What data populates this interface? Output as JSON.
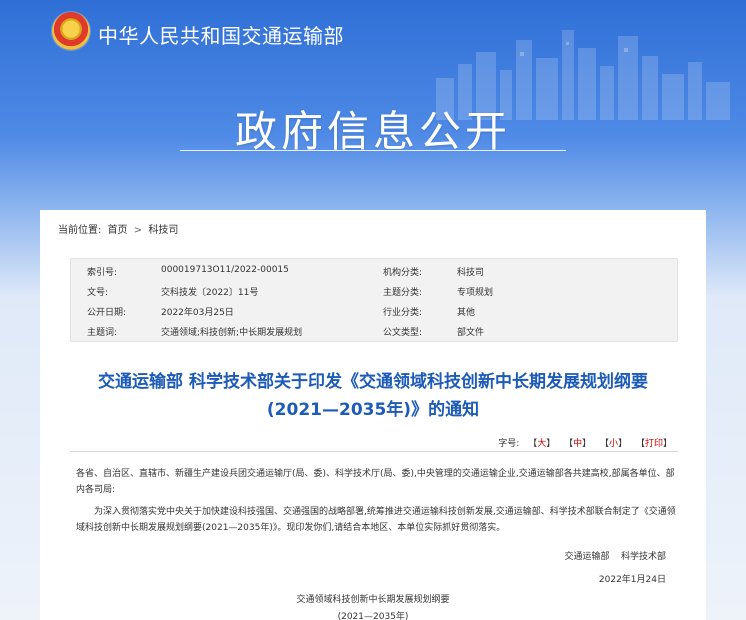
{
  "header": {
    "ministry_name": "中华人民共和国交通运输部",
    "banner_title": "政府信息公开"
  },
  "breadcrumb": {
    "label": "当前位置:",
    "items": [
      "首页",
      "科技司"
    ],
    "separator": ">"
  },
  "meta": {
    "rows": [
      {
        "label1": "索引号:",
        "value1": "000019713O11/2022-00015",
        "label2": "机构分类:",
        "value2": "科技司"
      },
      {
        "label1": "文号:",
        "value1": "交科技发〔2022〕11号",
        "label2": "主题分类:",
        "value2": "专项规划"
      },
      {
        "label1": "公开日期:",
        "value1": "2022年03月25日",
        "label2": "行业分类:",
        "value2": "其他"
      },
      {
        "label1": "主题词:",
        "value1": "交通领域;科技创新;中长期发展规划",
        "label2": "公文类型:",
        "value2": "部文件"
      }
    ]
  },
  "document": {
    "title_line1": "交通运输部 科学技术部关于印发《交通领域科技创新中长期发展规划纲要",
    "title_line2": "(2021—2035年)》的通知",
    "toolbar": {
      "font_size_label": "字号:",
      "large": "大",
      "medium": "中",
      "small": "小",
      "print": "打印"
    },
    "para1": "各省、自治区、直辖市、新疆生产建设兵团交通运输厅(局、委)、科学技术厅(局、委),中央管理的交通运输企业,交通运输部各共建高校,部属各单位、部内各司局:",
    "para2": "为深入贯彻落实党中央关于加快建设科技强国、交通强国的战略部署,统筹推进交通运输科技创新发展,交通运输部、科学技术部联合制定了《交通领域科技创新中长期发展规划纲要(2021—2035年)》。现印发你们,请结合本地区、本单位实际抓好贯彻落实。",
    "signer": "交通运输部    科学技术部",
    "date": "2022年1月24日",
    "sub_title1": "交通领域科技创新中长期发展规划纲要",
    "sub_title2": "(2021—2035年)"
  },
  "colors": {
    "title_blue": "#1d5bb8",
    "header_blue": "#2f6fd6",
    "toolbar_red": "#cc0000"
  },
  "icons": {
    "emblem": "national-emblem-icon"
  }
}
